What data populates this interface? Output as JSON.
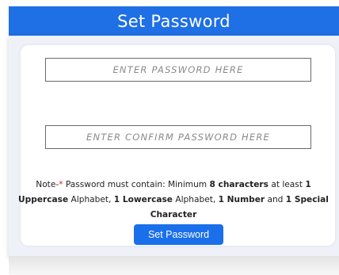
{
  "header": {
    "title": "Set Password"
  },
  "form": {
    "password_placeholder": "ENTER PASSWORD HERE",
    "confirm_placeholder": "ENTER CONFIRM PASSWORD HERE",
    "submit_label": "Set Password"
  },
  "note": {
    "prefix": "Note-",
    "star": "*",
    "t1": " Password must contain: Minimum ",
    "b1": "8 characters",
    "t2": " at least ",
    "b2": "1 Uppercase",
    "t3": " Alphabet, ",
    "b3": "1 Lowercase",
    "t4": " Alphabet, ",
    "b4": "1 Number",
    "t5": " and ",
    "b5": "1 Special Character"
  },
  "colors": {
    "header_bg": "#1f6fe5",
    "button_bg": "#1a6fea",
    "required_star": "#e02020"
  }
}
